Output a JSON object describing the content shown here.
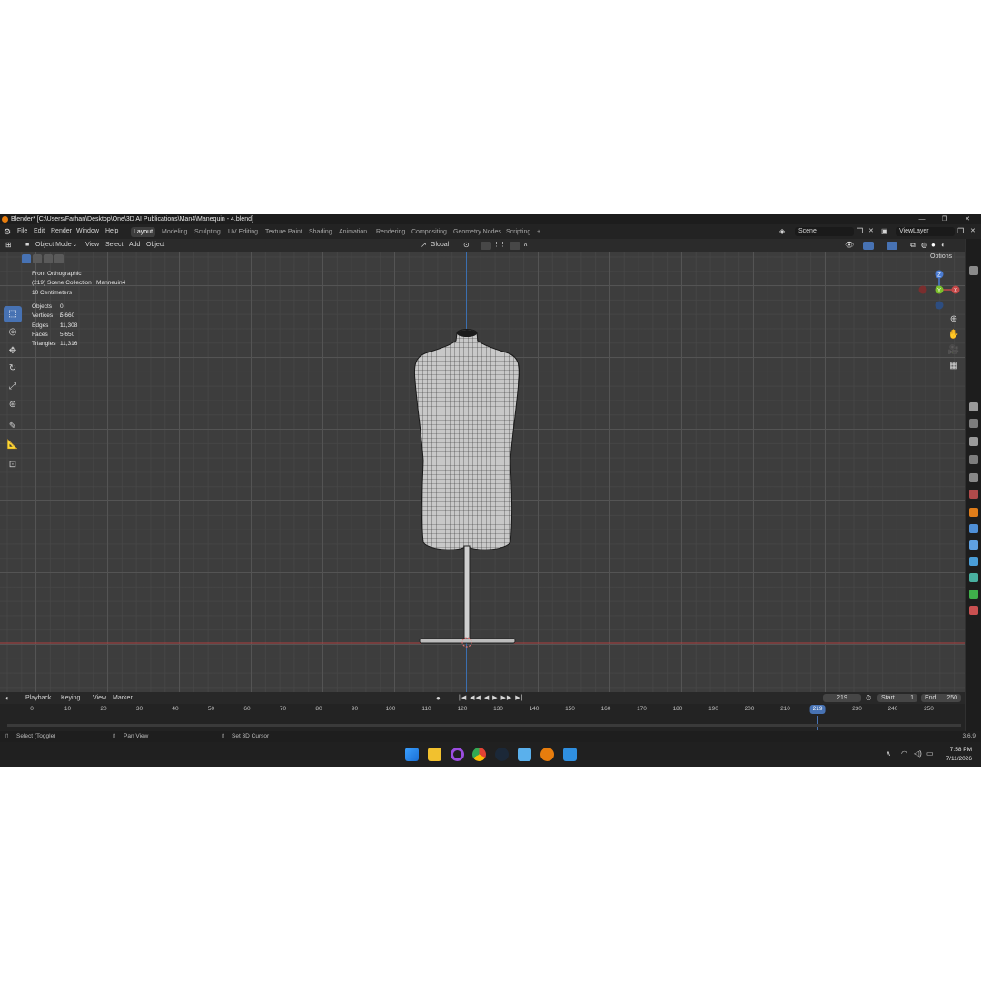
{
  "window": {
    "title": "Blender* [C:\\Users\\Farhan\\Desktop\\One\\3D AI Publications\\Man4\\Manequin - 4.blend]",
    "controls": [
      "—",
      "❐",
      "✕"
    ]
  },
  "menubar": {
    "menus": [
      "File",
      "Edit",
      "Render",
      "Window",
      "Help"
    ],
    "workspaces": [
      "Layout",
      "Modeling",
      "Sculpting",
      "UV Editing",
      "Texture Paint",
      "Shading",
      "Animation",
      "Rendering",
      "Compositing",
      "Geometry Nodes",
      "Scripting"
    ],
    "active_workspace": "Layout",
    "add_tab": "+",
    "scene": "Scene",
    "view_layer": "ViewLayer"
  },
  "viewport_header": {
    "mode": "Object Mode",
    "menus": [
      "View",
      "Select",
      "Add",
      "Object"
    ],
    "transform_orientation": "Global",
    "options": "Options"
  },
  "viewport": {
    "view_name": "Front Orthographic",
    "collection": "(219) Scene Collection | Manneuin4",
    "scale": "10 Centimeters",
    "stats": [
      {
        "label": "Objects",
        "value": "0 / 1"
      },
      {
        "label": "Vertices",
        "value": "5,660"
      },
      {
        "label": "Edges",
        "value": "11,308"
      },
      {
        "label": "Faces",
        "value": "5,650"
      },
      {
        "label": "Triangles",
        "value": "11,316"
      }
    ],
    "gizmo": {
      "z": "Z",
      "y": "Y",
      "x": "X"
    }
  },
  "timeline": {
    "menus": [
      "Playback",
      "Keying",
      "View",
      "Marker"
    ],
    "current_frame": "219",
    "start_label": "Start",
    "start": "1",
    "end_label": "End",
    "end": "250",
    "ticks": [
      "0",
      "10",
      "20",
      "30",
      "40",
      "50",
      "60",
      "70",
      "80",
      "90",
      "100",
      "110",
      "120",
      "130",
      "140",
      "150",
      "160",
      "170",
      "180",
      "190",
      "200",
      "210",
      "230",
      "240",
      "250"
    ]
  },
  "statusbar": {
    "hint_1": "Select (Toggle)",
    "hint_2": "Pan View",
    "hint_3": "Set 3D Cursor",
    "version": "3.6.9"
  },
  "taskbar": {
    "time": "7:58 PM",
    "date": "7/11/2026",
    "apps": [
      "windows-start",
      "file-explorer",
      "cortana",
      "chrome",
      "steam",
      "notepad",
      "blender",
      "paint"
    ]
  },
  "colors": {
    "accent": "#4772b3",
    "x_axis": "#c54848",
    "y_axis": "#7bbf2a",
    "z_axis": "#4a7bd1"
  }
}
